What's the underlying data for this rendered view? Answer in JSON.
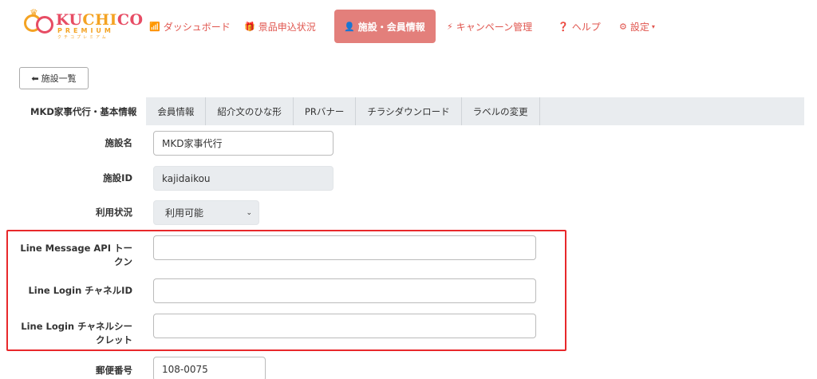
{
  "brand": {
    "name_left": "KU",
    "name_mid": "CHI",
    "name_right": "CO",
    "subtitle": "PREMIUM",
    "kana": "クチコプレミアム",
    "accent_color": "#e74c64",
    "secondary_color": "#f4a323"
  },
  "nav": {
    "dashboard": {
      "label": "ダッシュボード",
      "icon": "bar-chart-icon",
      "glyph": "📶"
    },
    "prize": {
      "label": "景品申込状況",
      "icon": "gift-icon",
      "glyph": "🎁"
    },
    "facility": {
      "label": "施設・会員情報",
      "icon": "user-icon",
      "glyph": "👤"
    },
    "campaign": {
      "label": "キャンペーン管理",
      "icon": "lightning-icon",
      "glyph": "⚡"
    },
    "help": {
      "label": "ヘルプ",
      "icon": "question-circle-icon",
      "glyph": "❓"
    },
    "settings": {
      "label": "設定",
      "icon": "gear-icon",
      "glyph": "⚙",
      "caret": "▾"
    },
    "active_color": "#e37f7b"
  },
  "back_button": {
    "label": "施設一覧",
    "icon": "arrow-left-icon",
    "glyph": "⬅"
  },
  "tabs": [
    {
      "label": "MKD家事代行・基本情報",
      "active": true
    },
    {
      "label": "会員情報"
    },
    {
      "label": "紹介文のひな形"
    },
    {
      "label": "PRバナー"
    },
    {
      "label": "チラシダウンロード"
    },
    {
      "label": "ラベルの変更"
    }
  ],
  "form": {
    "facility_name": {
      "label": "施設名",
      "value": "MKD家事代行"
    },
    "facility_id": {
      "label": "施設ID",
      "value": "kajidaikou"
    },
    "usage_status": {
      "label": "利用状況",
      "value": "利用可能"
    },
    "line_message_token": {
      "label_line1": "Line Message API トー",
      "label_line2": "クン",
      "value": ""
    },
    "line_login_channel_id": {
      "label": "Line Login チャネルID",
      "value": ""
    },
    "line_login_channel_secret": {
      "label_line1": "Line Login チャネルシー",
      "label_line2": "クレット",
      "value": ""
    },
    "postal_code": {
      "label": "郵便番号",
      "value": "108-0075"
    }
  },
  "highlight_color": "#e8282b"
}
